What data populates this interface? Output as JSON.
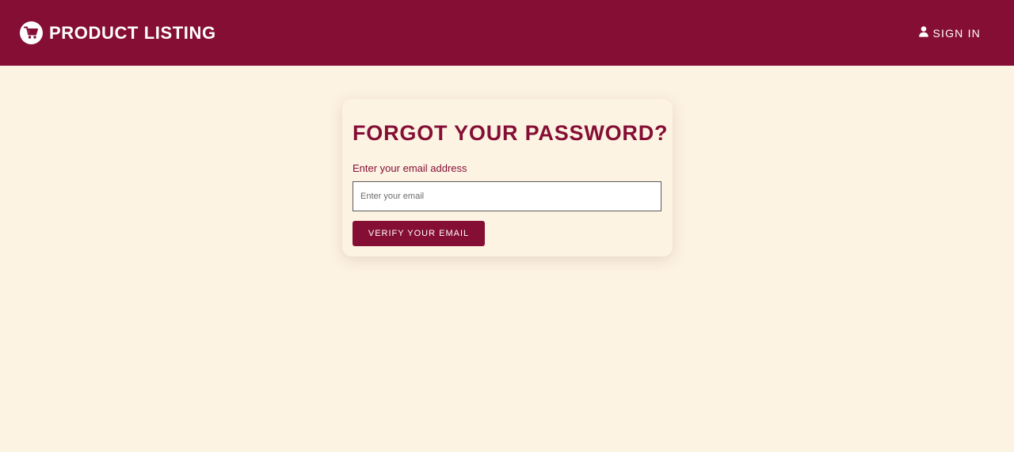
{
  "header": {
    "brand_title": "PRODUCT LISTING",
    "brand_icon": "shopping-cart-icon",
    "signin_label": "SIGN IN",
    "signin_icon": "user-icon"
  },
  "form": {
    "title": "FORGOT YOUR PASSWORD?",
    "email_label": "Enter your email address",
    "email_placeholder": "Enter your email",
    "email_value": "",
    "submit_label": "VERIFY YOUR EMAIL"
  },
  "colors": {
    "primary": "#850e35",
    "background": "#fdf3e3",
    "text_on_primary": "#ffffff"
  }
}
